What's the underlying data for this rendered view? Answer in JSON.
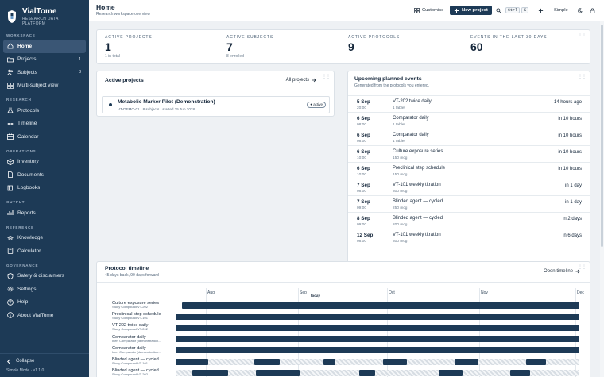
{
  "app": {
    "name": "VialTome",
    "tagline": "RESEARCH DATA PLATFORM"
  },
  "sidebar": {
    "sections": [
      {
        "title": "WORKSPACE",
        "items": [
          {
            "label": "Home",
            "icon": "home-icon",
            "active": true,
            "count": ""
          },
          {
            "label": "Projects",
            "icon": "folder-icon",
            "count": "1"
          },
          {
            "label": "Subjects",
            "icon": "users-icon",
            "count": "8"
          },
          {
            "label": "Multi-subject view",
            "icon": "grid-icon",
            "count": ""
          }
        ]
      },
      {
        "title": "RESEARCH",
        "items": [
          {
            "label": "Protocols",
            "icon": "flask-icon",
            "count": ""
          },
          {
            "label": "Timeline",
            "icon": "timeline-icon",
            "count": ""
          },
          {
            "label": "Calendar",
            "icon": "calendar-icon",
            "count": ""
          }
        ]
      },
      {
        "title": "OPERATIONS",
        "items": [
          {
            "label": "Inventory",
            "icon": "box-icon",
            "count": ""
          },
          {
            "label": "Documents",
            "icon": "document-icon",
            "count": ""
          },
          {
            "label": "Logbooks",
            "icon": "book-icon",
            "count": ""
          }
        ]
      },
      {
        "title": "OUTPUT",
        "items": [
          {
            "label": "Reports",
            "icon": "report-icon",
            "count": ""
          }
        ]
      },
      {
        "title": "REFERENCE",
        "items": [
          {
            "label": "Knowledge",
            "icon": "knowledge-icon",
            "count": ""
          },
          {
            "label": "Calculator",
            "icon": "calculator-icon",
            "count": ""
          }
        ]
      },
      {
        "title": "GOVERNANCE",
        "items": [
          {
            "label": "Safety & disclaimers",
            "icon": "shield-icon",
            "count": ""
          },
          {
            "label": "Settings",
            "icon": "gear-icon",
            "count": ""
          },
          {
            "label": "Help",
            "icon": "help-icon",
            "count": ""
          },
          {
            "label": "About VialTome",
            "icon": "info-icon",
            "count": ""
          }
        ]
      }
    ],
    "collapse_label": "Collapse",
    "version": "Simple Mode · v1.1.0"
  },
  "header": {
    "title": "Home",
    "subtitle": "Research workspace overview",
    "customise_label": "Customise",
    "new_project_label": "New project",
    "kbd_ctrl": "Ctrl",
    "kbd_k": "K",
    "mode_label": "Simple"
  },
  "stats": [
    {
      "label": "ACTIVE PROJECTS",
      "value": "1",
      "sub": "1 in total"
    },
    {
      "label": "ACTIVE SUBJECTS",
      "value": "7",
      "sub": "8 enrolled"
    },
    {
      "label": "ACTIVE PROTOCOLS",
      "value": "9",
      "sub": ""
    },
    {
      "label": "EVENTS IN THE LAST 30 DAYS",
      "value": "60",
      "sub": ""
    }
  ],
  "projects": {
    "title": "Active projects",
    "all_link": "All projects",
    "items": [
      {
        "name": "Metabolic Marker Pilot (Demonstration)",
        "meta": "VT-DEMO-01 · 8 subjects · started 25 Jun 2028",
        "status": "active"
      }
    ]
  },
  "events": {
    "title": "Upcoming planned events",
    "subtitle": "Generated from the protocols you entered.",
    "items": [
      {
        "date": "5 Sep",
        "time": "20:00",
        "name": "VT-202 twice daily",
        "dose": "1 tablet",
        "rel": "14 hours ago"
      },
      {
        "date": "6 Sep",
        "time": "08:00",
        "name": "Comparator daily",
        "dose": "1 tablet",
        "rel": "in 10 hours"
      },
      {
        "date": "6 Sep",
        "time": "08:00",
        "name": "Comparator daily",
        "dose": "1 tablet",
        "rel": "in 10 hours"
      },
      {
        "date": "6 Sep",
        "time": "10:00",
        "name": "Culture exposure series",
        "dose": "150 mcg",
        "rel": "in 10 hours"
      },
      {
        "date": "6 Sep",
        "time": "10:00",
        "name": "Preclinical step schedule",
        "dose": "150 mcg",
        "rel": "in 10 hours"
      },
      {
        "date": "7 Sep",
        "time": "08:00",
        "name": "VT-101 weekly titration",
        "dose": "300 mcg",
        "rel": "in 1 day"
      },
      {
        "date": "7 Sep",
        "time": "09:00",
        "name": "Blinded agent — cycled",
        "dose": "250 mcg",
        "rel": "in 1 day"
      },
      {
        "date": "8 Sep",
        "time": "09:00",
        "name": "Blinded agent — cycled",
        "dose": "200 mcg",
        "rel": "in 2 days"
      },
      {
        "date": "12 Sep",
        "time": "08:00",
        "name": "VT-101 weekly titration",
        "dose": "300 mcg",
        "rel": "in 6 days"
      }
    ]
  },
  "timeline": {
    "title": "Protocol timeline",
    "subtitle": "45 days back, 90 days forward",
    "open_link": "Open timeline",
    "months": [
      "Aug",
      "Sep",
      "Oct",
      "Nov",
      "Dec"
    ],
    "today_label": "today",
    "rows": [
      {
        "name": "Culture exposure series",
        "sub": "Study Compound VT-202",
        "style": "solid"
      },
      {
        "name": "Preclinical step schedule",
        "sub": "Study Compound VT-101",
        "style": "solid"
      },
      {
        "name": "VT-202 twice daily",
        "sub": "Study Compound VT-202",
        "style": "solid"
      },
      {
        "name": "Comparator daily",
        "sub": "Inert Comparator (demonstration...",
        "style": "solid"
      },
      {
        "name": "Comparator daily",
        "sub": "Inert Comparator (demonstration...",
        "style": "solid"
      },
      {
        "name": "Blinded agent — cycled",
        "sub": "Study Compound VT-101",
        "style": "cycled"
      },
      {
        "name": "Blinded agent — cycled",
        "sub": "Study Compound VT-202",
        "style": "cycled"
      }
    ]
  },
  "colors": {
    "brand": "#1d3a56",
    "sidebar_active": "#3a5675",
    "background": "#eef1f4"
  }
}
